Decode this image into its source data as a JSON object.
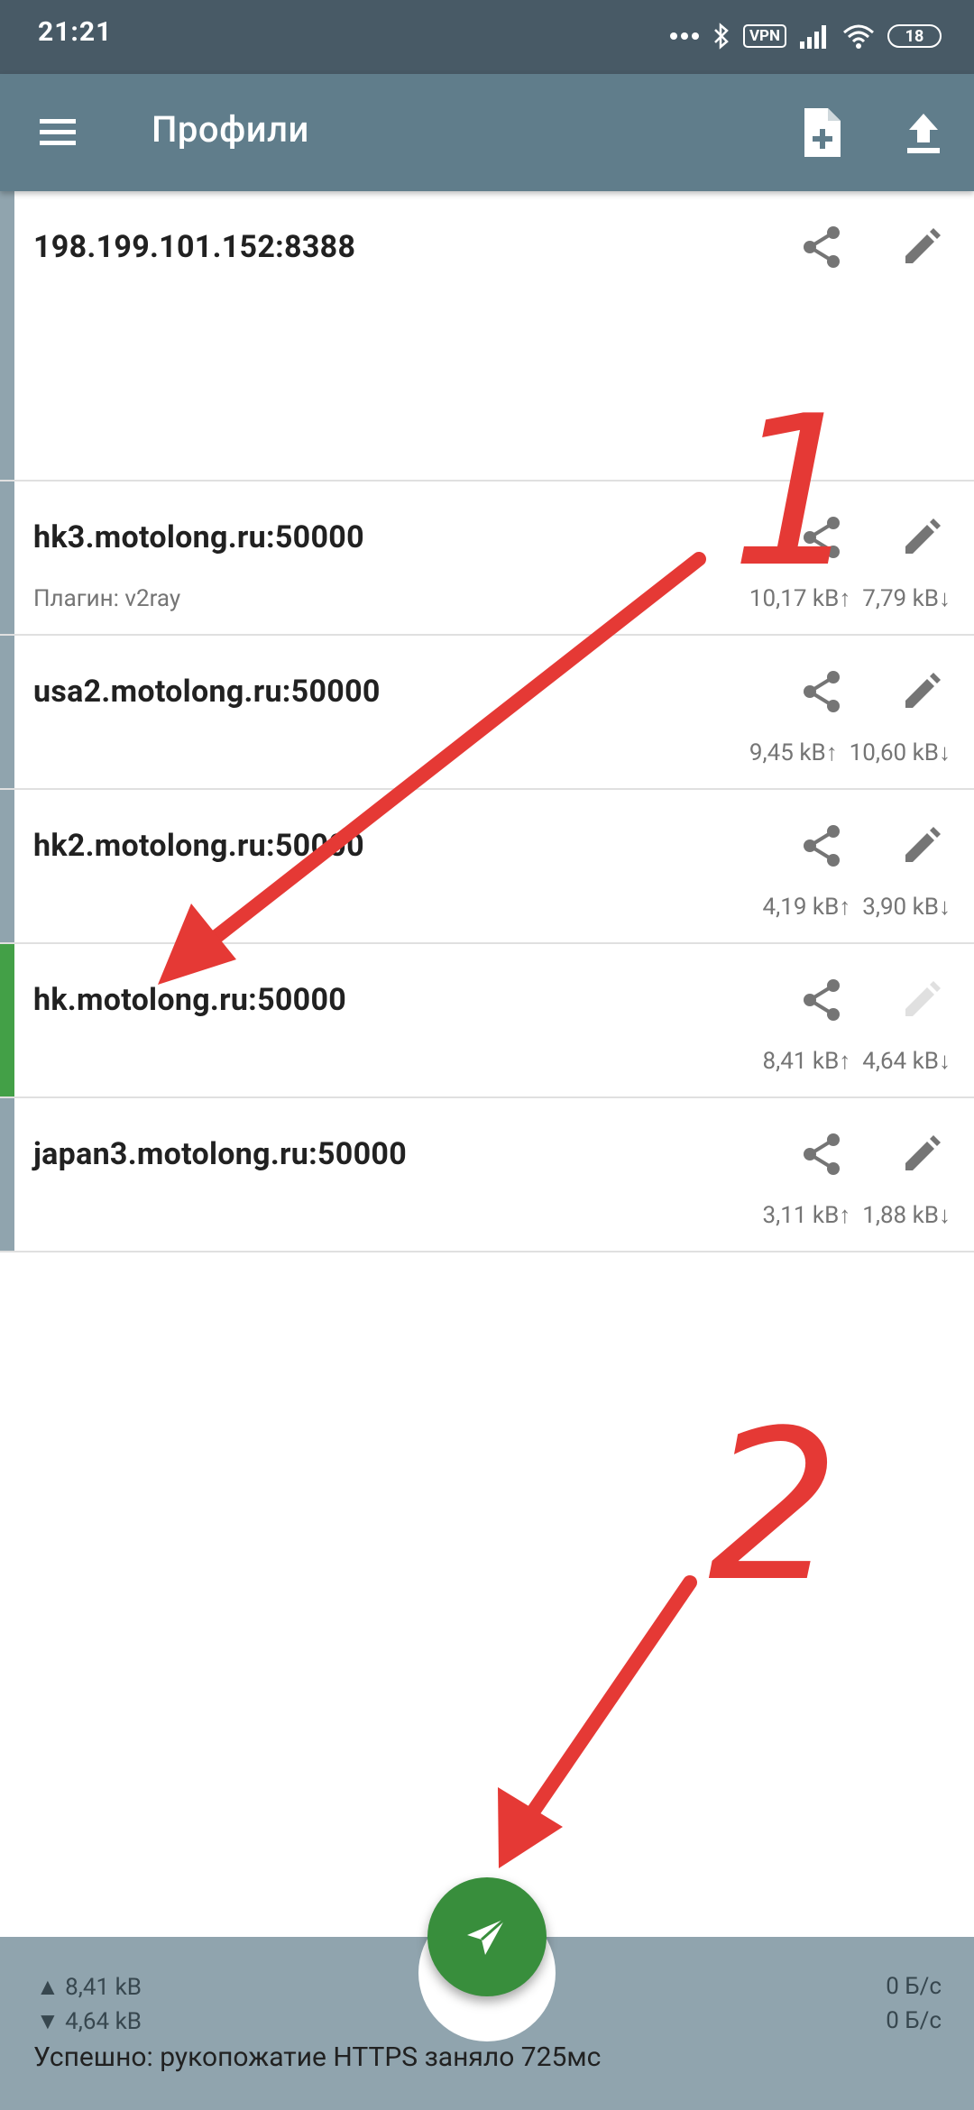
{
  "status_bar": {
    "time": "21:21",
    "vpn": "VPN",
    "battery": "18"
  },
  "app_bar": {
    "title": "Профили",
    "menu_icon": "menu-icon",
    "add_icon": "add-file-icon",
    "upload_icon": "upload-icon"
  },
  "profiles": [
    {
      "name": "198.199.101.152:8388",
      "plugin": "",
      "traffic": "",
      "active": false
    },
    {
      "name": "hk3.motolong.ru:50000",
      "plugin": "Плагин: v2ray",
      "traffic": "10,17 kB↑  7,79 kB↓",
      "active": false
    },
    {
      "name": "usa2.motolong.ru:50000",
      "plugin": "",
      "traffic": "9,45 kB↑  10,60 kB↓",
      "active": false
    },
    {
      "name": "hk2.motolong.ru:50000",
      "plugin": "",
      "traffic": "4,19 kB↑  3,90 kB↓",
      "active": false
    },
    {
      "name": "hk.motolong.ru:50000",
      "plugin": "",
      "traffic": "8,41 kB↑  4,64 kB↓",
      "active": true
    },
    {
      "name": "japan3.motolong.ru:50000",
      "plugin": "",
      "traffic": "3,11 kB↑  1,88 kB↓",
      "active": false
    }
  ],
  "bottom": {
    "tx_total": "▲ 8,41 kB",
    "rx_total": "▼ 4,64 kB",
    "tx_rate": "0 Б/с",
    "rx_rate": "0 Б/с",
    "status": "Успешно: рукопожатие HTTPS заняло 725мс",
    "fab_icon": "send-icon"
  },
  "annotations": {
    "label_1": "1",
    "label_2": "2",
    "color": "#e53935"
  },
  "colors": {
    "appbar": "#607d8b",
    "statusbar": "#485a66",
    "active": "#43a047",
    "inactive": "#90a4ae",
    "fab": "#388e3c"
  }
}
